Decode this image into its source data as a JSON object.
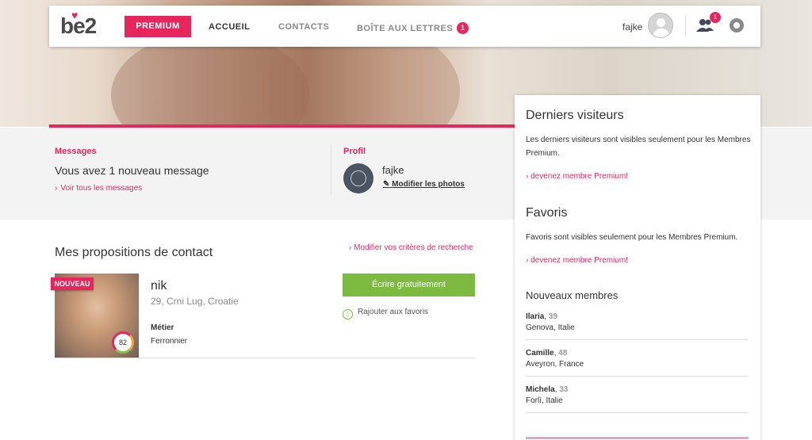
{
  "brand": {
    "logo": "be2",
    "accent": "#e8265e",
    "green": "#7dba40"
  },
  "nav": {
    "premium": "PREMIUM",
    "items": [
      "ACCUEIL",
      "CONTACTS",
      "BOÎTE AUX LETTRES"
    ],
    "mailbox_badge": "1",
    "username": "fajke",
    "contacts_badge": "1"
  },
  "messages": {
    "label": "Messages",
    "text": "Vous avez 1 nouveau message",
    "link": "Voir tous les messages"
  },
  "profile": {
    "label": "Profil",
    "name": "fajke",
    "edit": "Modifier les photos"
  },
  "proposals": {
    "title": "Mes propositions de contact",
    "modify_link": "Modifier vos critères de recherche",
    "card": {
      "badge": "NOUVEAU",
      "score": "82",
      "name": "nik",
      "location": "29, Crni Lug, Croatie",
      "job_label": "Métier",
      "job": "Ferronnier",
      "write_button": "Écrire gratuitement",
      "favorite": "Rajouter aux favoris"
    }
  },
  "panel": {
    "visitors_title": "Derniers visiteurs",
    "visitors_text": "Les derniers visiteurs sont visibles seulement pour les Membres Premium.",
    "visitors_link": "devenez membre Premium!",
    "favorites_title": "Favoris",
    "favorites_text": "Favoris sont visibles seulement pour les Membres Premium.",
    "favorites_link": "devenez membre Premium!",
    "new_members_title": "Nouveaux membres",
    "members": [
      {
        "name": "Ilaria",
        "age": "39",
        "place": "Genova, Italie"
      },
      {
        "name": "Camille",
        "age": "48",
        "place": "Aveyron, France"
      },
      {
        "name": "Michela",
        "age": "33",
        "place": "Forlì, Italie"
      }
    ]
  }
}
